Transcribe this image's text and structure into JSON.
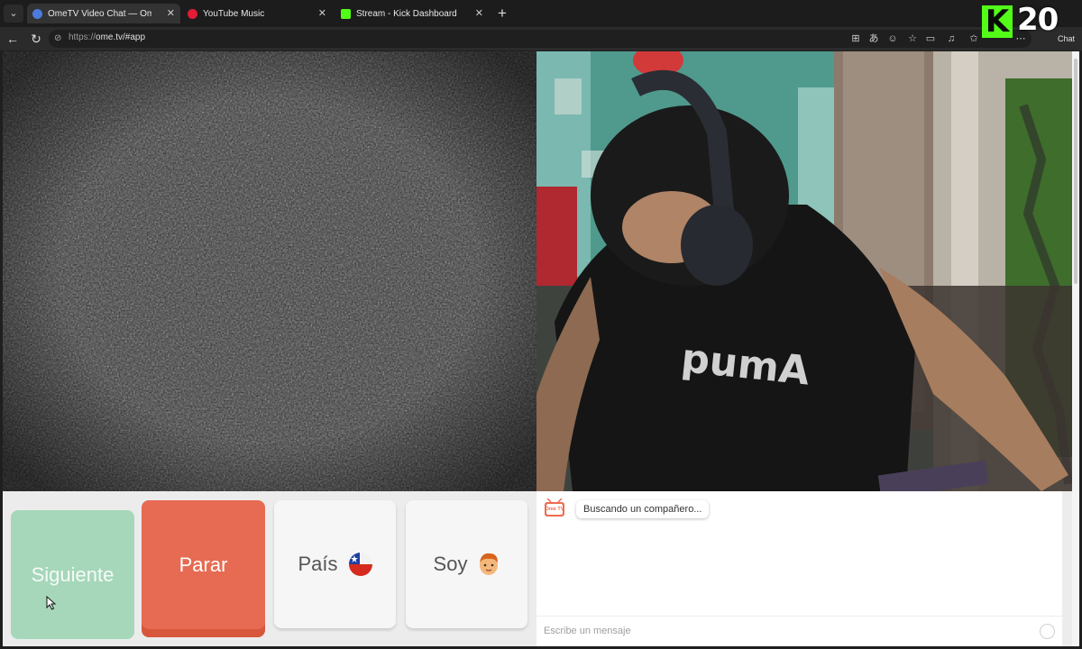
{
  "browser": {
    "tabs": [
      {
        "title": "OmeTV Video Chat — Omegl",
        "active": true,
        "favicon_color": "#4b7bdc"
      },
      {
        "title": "YouTube Music",
        "active": false,
        "favicon_color": "#e21b36"
      },
      {
        "title": "Stream - Kick Dashboard",
        "active": false,
        "favicon_color": "#53fc18"
      }
    ],
    "tab_close_glyph": "✕",
    "new_tab_glyph": "+",
    "url_scheme": "https://",
    "url_host": "ome.tv/#app",
    "chat_label": "Chat"
  },
  "overlay": {
    "kick_letter": "K",
    "counter": "20"
  },
  "controls": {
    "next_label": "Siguiente",
    "stop_label": "Parar",
    "country_label": "País",
    "iam_label": "Soy"
  },
  "chat": {
    "logo_text": "Ome TV",
    "status_message": "Buscando un compañero...",
    "input_placeholder": "Escribe un mensaje"
  },
  "colors": {
    "next_button": "#a6d7ba",
    "stop_button": "#e66b52",
    "kick_brand": "#53fc18"
  },
  "icons": [
    "tab-menu-icon",
    "back-icon",
    "reload-icon",
    "lock-icon",
    "smile-icon",
    "chile-flag-icon",
    "boy-emoji-icon"
  ]
}
